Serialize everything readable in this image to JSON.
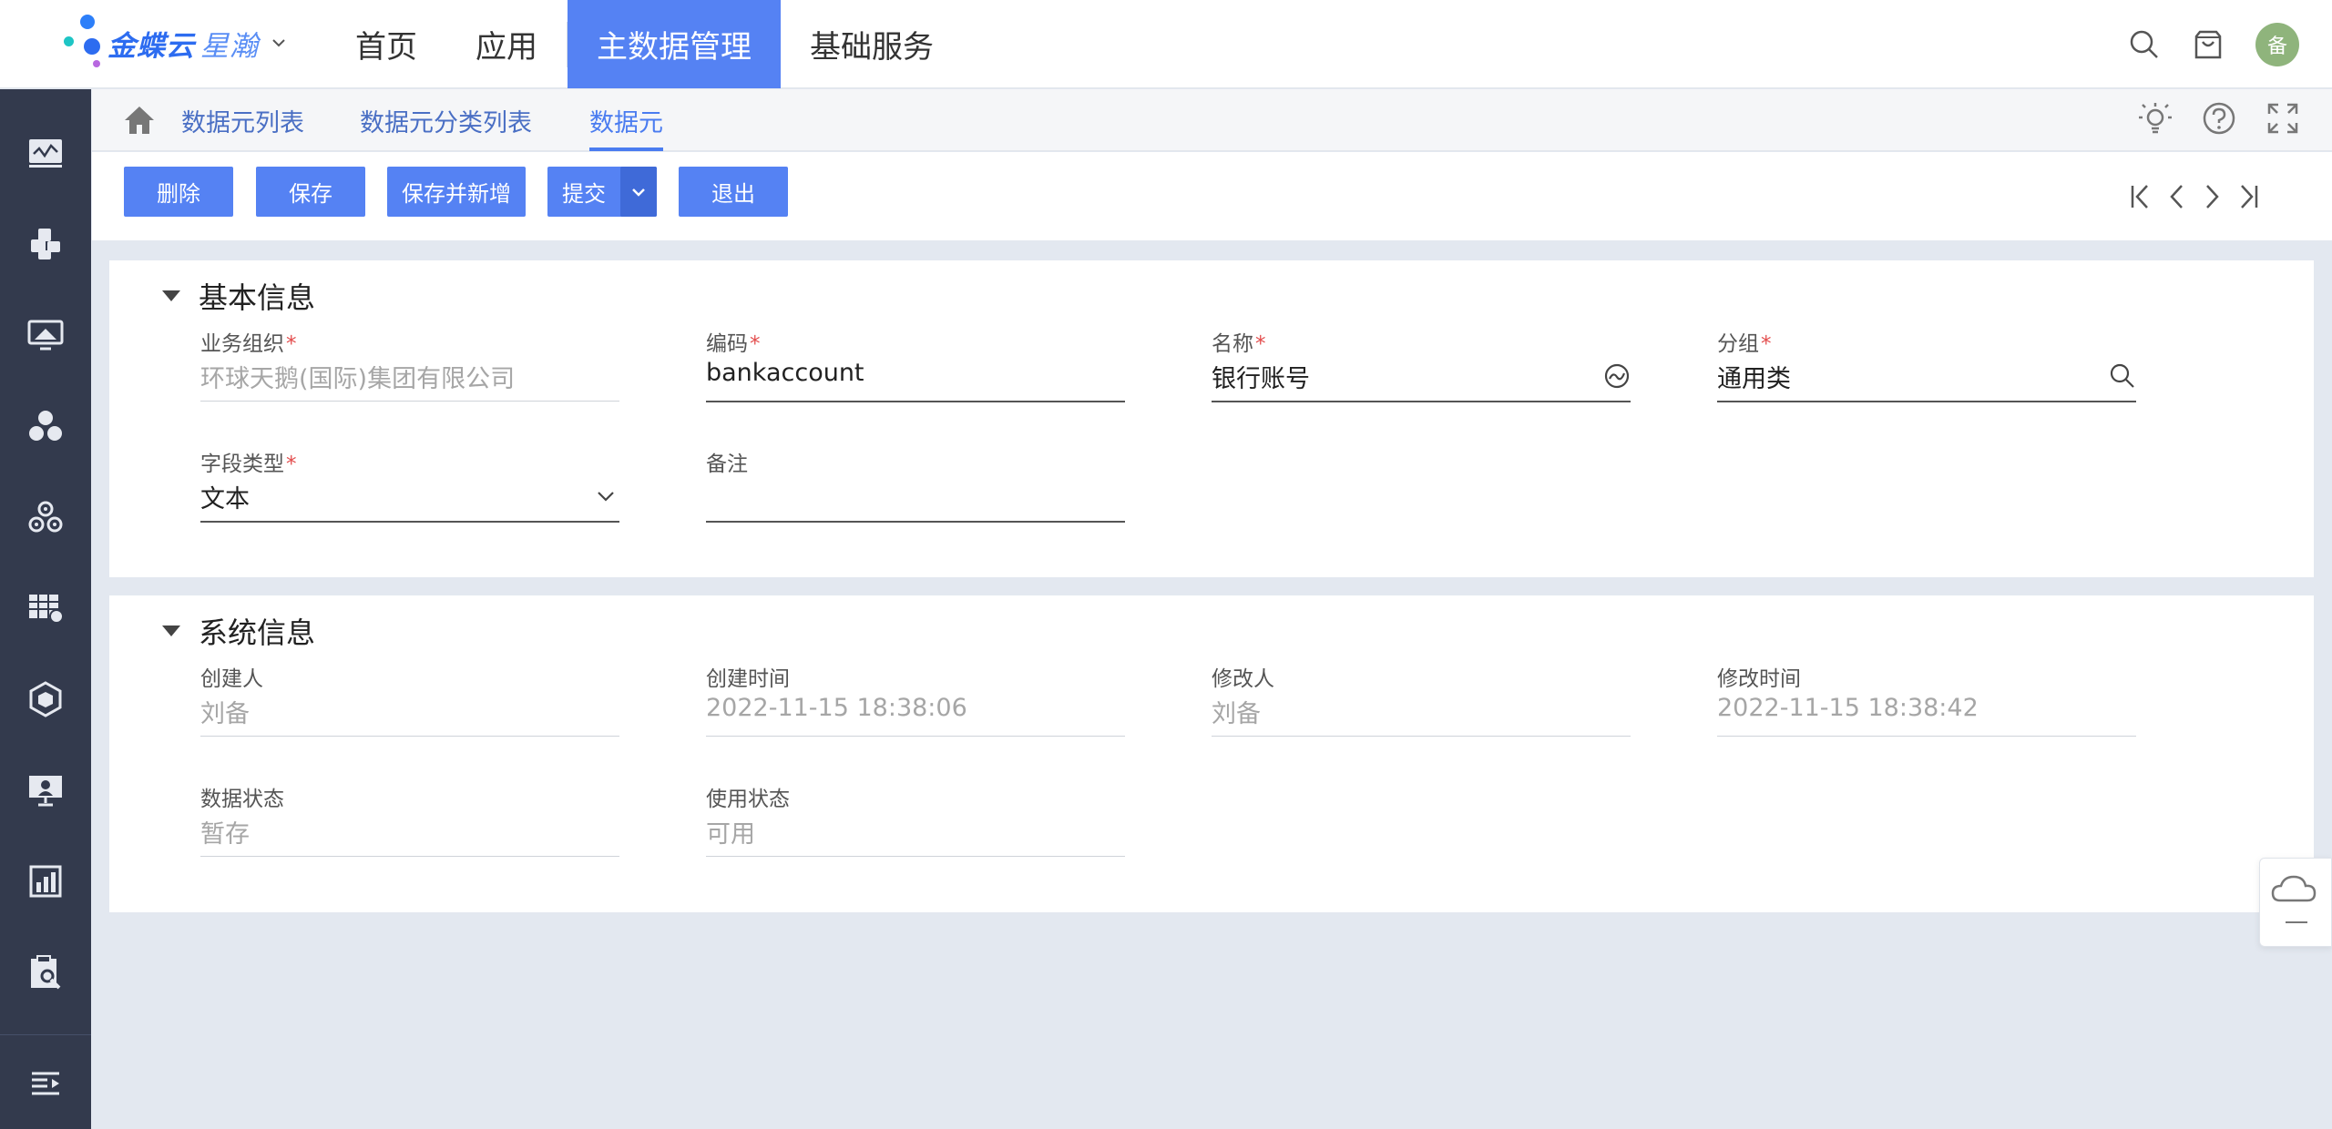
{
  "header": {
    "logo_text_bold": "金蝶云",
    "logo_text_light": "星瀚",
    "nav": [
      "首页",
      "应用",
      "主数据管理",
      "基础服务"
    ],
    "active_nav": 2,
    "avatar_text": "备",
    "colors": {
      "accent": "#5582f3",
      "avatar": "#8fb47c",
      "sidebar": "#333a4d"
    }
  },
  "tabs": {
    "items": [
      "数据元列表",
      "数据元分类列表",
      "数据元"
    ],
    "active": 2
  },
  "toolbar": {
    "delete": "删除",
    "save": "保存",
    "save_new": "保存并新增",
    "submit": "提交",
    "exit": "退出"
  },
  "basic": {
    "title": "基本信息",
    "org_label": "业务组织",
    "org_value": "环球天鹅(国际)集团有限公司",
    "code_label": "编码",
    "code_value": "bankaccount",
    "name_label": "名称",
    "name_value": "银行账号",
    "group_label": "分组",
    "group_value": "通用类",
    "type_label": "字段类型",
    "type_value": "文本",
    "remark_label": "备注",
    "remark_value": ""
  },
  "system": {
    "title": "系统信息",
    "creator_label": "创建人",
    "creator_value": "刘备",
    "created_label": "创建时间",
    "created_value": "2022-11-15 18:38:06",
    "modifier_label": "修改人",
    "modifier_value": "刘备",
    "modified_label": "修改时间",
    "modified_value": "2022-11-15 18:38:42",
    "data_status_label": "数据状态",
    "data_status_value": "暂存",
    "use_status_label": "使用状态",
    "use_status_value": "可用"
  },
  "icons": {
    "sidebar": [
      "monitor-chart-icon",
      "puzzle-icon",
      "screen-icon",
      "circles-icon",
      "gear-cluster-icon",
      "table-settings-icon",
      "cube-icon",
      "presentation-icon",
      "building-chart-icon",
      "clipboard-search-icon",
      "menu-expand-icon"
    ],
    "header": [
      "search-icon",
      "bag-icon"
    ],
    "tabbar": [
      "bulb-icon",
      "help-icon",
      "fullscreen-icon"
    ]
  }
}
